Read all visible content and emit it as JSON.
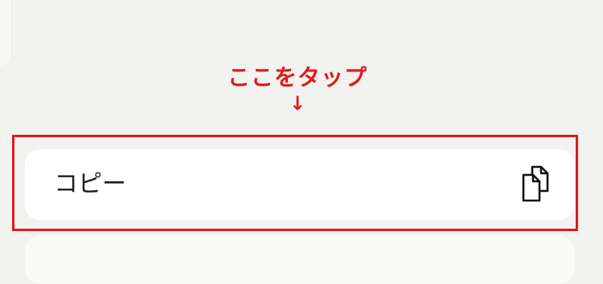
{
  "annotation": {
    "text": "ここをタップ",
    "arrow": "↓"
  },
  "menu": {
    "items": [
      {
        "label": "コピー",
        "icon": "copy-icon"
      }
    ]
  },
  "colors": {
    "background": "#f2f2f0",
    "card": "#ffffff",
    "highlight": "#e11b1b",
    "text": "#1d1d1d",
    "icon": "#111111"
  }
}
